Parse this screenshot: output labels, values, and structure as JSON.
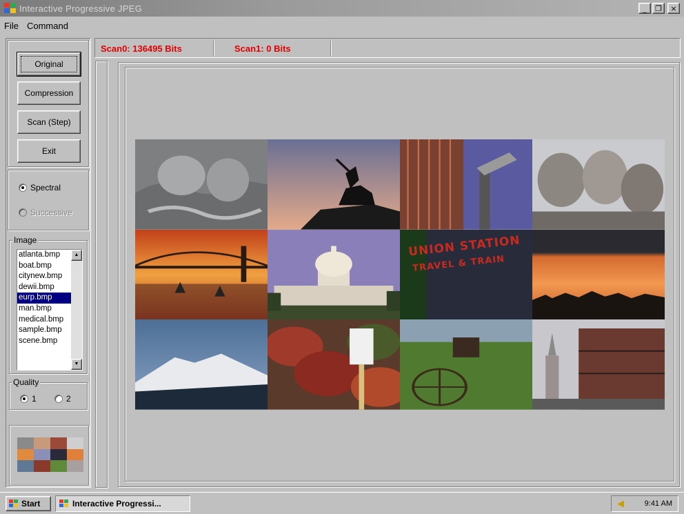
{
  "window": {
    "title": "Interactive Progressive JPEG",
    "minimize_glyph": "_",
    "maximize_glyph": "❐",
    "close_glyph": "×"
  },
  "menu": {
    "items": [
      "File",
      "Command"
    ]
  },
  "commands": {
    "original": "Original",
    "compression": "Compression",
    "scan_step": "Scan (Step)",
    "exit": "Exit"
  },
  "mode": {
    "spectral": "Spectral",
    "successive": "Successive",
    "selected": "Spectral"
  },
  "image_group": {
    "legend": "Image",
    "files": [
      "atlanta.bmp",
      "boat.bmp",
      "citynew.bmp",
      "dewii.bmp",
      "eurp.bmp",
      "man.bmp",
      "medical.bmp",
      "sample.bmp",
      "scene.bmp"
    ],
    "selected_index": 4
  },
  "quality_group": {
    "legend": "Quality",
    "options": [
      "1",
      "2"
    ],
    "selected": "1"
  },
  "status": {
    "scan0": "Scan0: 136495 Bits",
    "scan1": "Scan1: 0 Bits"
  },
  "mosaic": {
    "union_station_line1": "UNION STATION",
    "union_station_line2": "TRAVEL & TRAIN"
  },
  "taskbar": {
    "start_label": "Start",
    "task_label": "Interactive Progressi...",
    "clock": "9:41 AM"
  },
  "colors": {
    "scan_text": "#e00000",
    "selection": "#000080",
    "face": "#c0c0c0"
  }
}
